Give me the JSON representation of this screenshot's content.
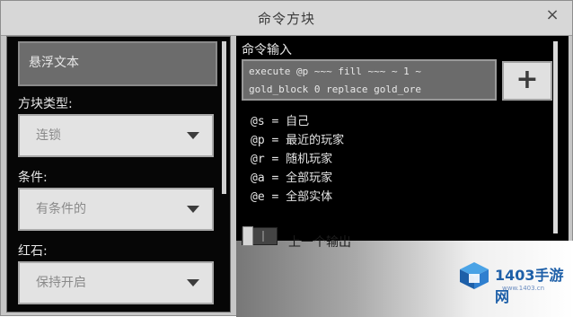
{
  "window": {
    "title": "命令方块",
    "close_glyph": "×"
  },
  "left_panel": {
    "hover_text": "悬浮文本",
    "block_type": {
      "label": "方块类型:",
      "value": "连锁"
    },
    "condition": {
      "label": "条件:",
      "value": "有条件的"
    },
    "redstone": {
      "label": "红石:",
      "value": "保持开启"
    }
  },
  "right_panel": {
    "command_label": "命令输入",
    "command_lines": [
      "execute @p ~~~ fill ~~~ ~ 1 ~",
      "gold_block 0 replace gold_ore"
    ],
    "add_button": "+",
    "selectors": [
      "@s = 自己",
      "@p = 最近的玩家",
      "@r = 随机玩家",
      "@a = 全部玩家",
      "@e = 全部实体"
    ],
    "previous_output_label": "上一个输出"
  },
  "watermark": {
    "brand": "1403手游网",
    "url": "www.1403.cn",
    "color": "#1d5fa8"
  }
}
